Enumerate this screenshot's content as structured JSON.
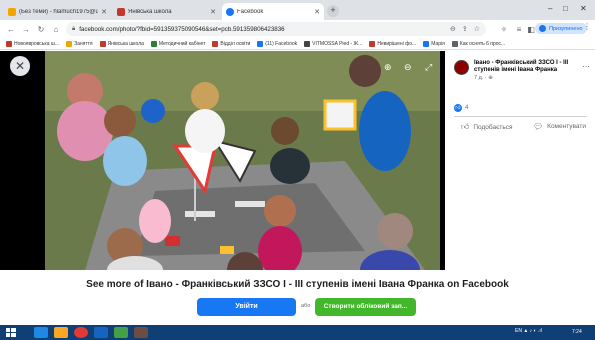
{
  "browser": {
    "tabs": [
      {
        "title": "(Без теми) - hlamuch1975@ukr.net",
        "icon_color": "#f0a500",
        "active": false
      },
      {
        "title": "Янівська школа",
        "icon_color": "#c0392b",
        "active": false
      },
      {
        "title": "Facebook",
        "icon_color": "#1877f2",
        "active": true
      }
    ],
    "new_tab_symbol": "+",
    "window_controls": {
      "minimize": "–",
      "maximize": "□",
      "close": "✕"
    },
    "url": "facebook.com/photo/?fbid=591359375090546&set=pcb.591359806423836",
    "profile_label": "Призупинено",
    "bookmarks": [
      {
        "label": "Новоявровська ш...",
        "color": "#c0392b"
      },
      {
        "label": "Заняття",
        "color": "#f0a500"
      },
      {
        "label": "Янівська школа",
        "color": "#c0392b"
      },
      {
        "label": "Методичний кабінет",
        "color": "#2e7d32"
      },
      {
        "label": "Відділ освіти",
        "color": "#c0392b"
      },
      {
        "label": "(11) Facebook",
        "color": "#1877f2"
      },
      {
        "label": "VITMOSSA Pied - Ж...",
        "color": "#444444"
      },
      {
        "label": "Невирішені фо...",
        "color": "#c0392b"
      },
      {
        "label": "Марія",
        "color": "#1877f2"
      },
      {
        "label": "Как оснять 6 прос...",
        "color": "#5f6368"
      }
    ]
  },
  "viewer": {
    "close_symbol": "✕"
  },
  "post": {
    "page_name": "Івано - Франківський ЗЗСО І - ІІІ ступенів імені Івана Франка",
    "meta": "7 д. · ⊕",
    "reactions_count": "4",
    "like_label": "Подобається",
    "comment_label": "Коментувати"
  },
  "login_prompt": {
    "title": "See more of Івано - Франківський ЗЗСО І - ІІІ ступенів імені Івана Франка on Facebook",
    "login_label": "Увійти",
    "or_label": "або",
    "signup_label": "Створити обліковий зап..."
  },
  "taskbar": {
    "tray_text": "EN ▲ ♪ ◐ .ıl",
    "clock": "7:24"
  },
  "colors": {
    "facebook_blue": "#1877f2",
    "signup_green": "#42b72a",
    "taskbar": "#0f3f74"
  }
}
